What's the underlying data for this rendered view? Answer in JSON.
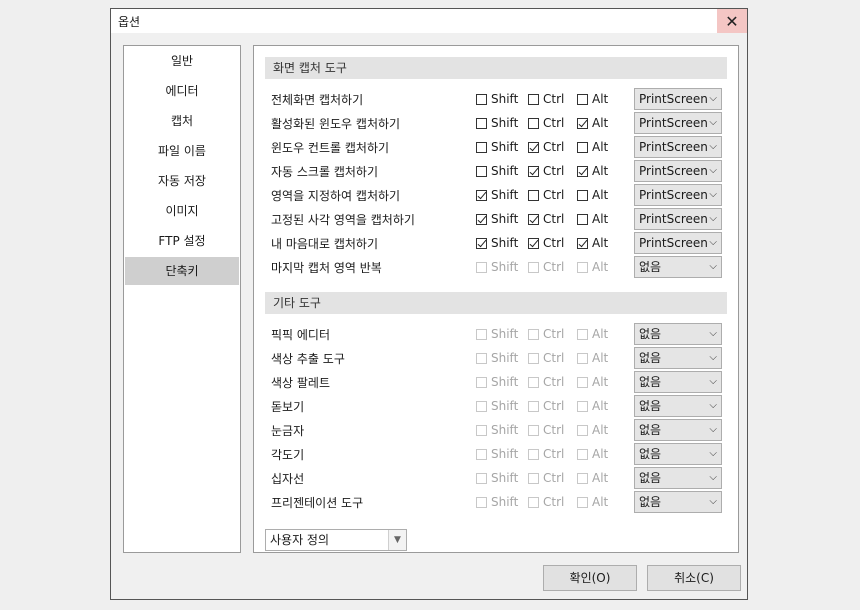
{
  "window": {
    "title": "옵션",
    "close_icon": "close-icon"
  },
  "sidebar": {
    "items": [
      {
        "label": "일반",
        "selected": false
      },
      {
        "label": "에디터",
        "selected": false
      },
      {
        "label": "캡처",
        "selected": false
      },
      {
        "label": "파일 이름",
        "selected": false
      },
      {
        "label": "자동 저장",
        "selected": false
      },
      {
        "label": "이미지",
        "selected": false
      },
      {
        "label": "FTP 설정",
        "selected": false
      },
      {
        "label": "단축키",
        "selected": true
      }
    ]
  },
  "modifier_labels": {
    "shift": "Shift",
    "ctrl": "Ctrl",
    "alt": "Alt"
  },
  "sections": [
    {
      "header": "화면 캡처 도구",
      "rows": [
        {
          "label": "전체화면 캡처하기",
          "shift": false,
          "ctrl": false,
          "alt": false,
          "key": "PrintScreen",
          "enabled": true
        },
        {
          "label": "활성화된 윈도우 캡처하기",
          "shift": false,
          "ctrl": false,
          "alt": true,
          "key": "PrintScreen",
          "enabled": true
        },
        {
          "label": "윈도우 컨트롤 캡처하기",
          "shift": false,
          "ctrl": true,
          "alt": false,
          "key": "PrintScreen",
          "enabled": true
        },
        {
          "label": "자동 스크롤 캡처하기",
          "shift": false,
          "ctrl": true,
          "alt": true,
          "key": "PrintScreen",
          "enabled": true
        },
        {
          "label": "영역을 지정하여 캡처하기",
          "shift": true,
          "ctrl": false,
          "alt": false,
          "key": "PrintScreen",
          "enabled": true
        },
        {
          "label": "고정된 사각 영역을 캡처하기",
          "shift": true,
          "ctrl": true,
          "alt": false,
          "key": "PrintScreen",
          "enabled": true
        },
        {
          "label": "내 마음대로 캡처하기",
          "shift": true,
          "ctrl": true,
          "alt": true,
          "key": "PrintScreen",
          "enabled": true
        },
        {
          "label": "마지막 캡처 영역 반복",
          "shift": false,
          "ctrl": false,
          "alt": false,
          "key": "없음",
          "enabled": false
        }
      ]
    },
    {
      "header": "기타 도구",
      "rows": [
        {
          "label": "픽픽 에디터",
          "shift": false,
          "ctrl": false,
          "alt": false,
          "key": "없음",
          "enabled": false
        },
        {
          "label": "색상 추출 도구",
          "shift": false,
          "ctrl": false,
          "alt": false,
          "key": "없음",
          "enabled": false
        },
        {
          "label": "색상 팔레트",
          "shift": false,
          "ctrl": false,
          "alt": false,
          "key": "없음",
          "enabled": false
        },
        {
          "label": "돋보기",
          "shift": false,
          "ctrl": false,
          "alt": false,
          "key": "없음",
          "enabled": false
        },
        {
          "label": "눈금자",
          "shift": false,
          "ctrl": false,
          "alt": false,
          "key": "없음",
          "enabled": false
        },
        {
          "label": "각도기",
          "shift": false,
          "ctrl": false,
          "alt": false,
          "key": "없음",
          "enabled": false
        },
        {
          "label": "십자선",
          "shift": false,
          "ctrl": false,
          "alt": false,
          "key": "없음",
          "enabled": false
        },
        {
          "label": "프리젠테이션 도구",
          "shift": false,
          "ctrl": false,
          "alt": false,
          "key": "없음",
          "enabled": false
        }
      ]
    }
  ],
  "preset": {
    "value": "사용자 정의"
  },
  "buttons": {
    "ok": "확인(O)",
    "cancel": "취소(C)"
  }
}
